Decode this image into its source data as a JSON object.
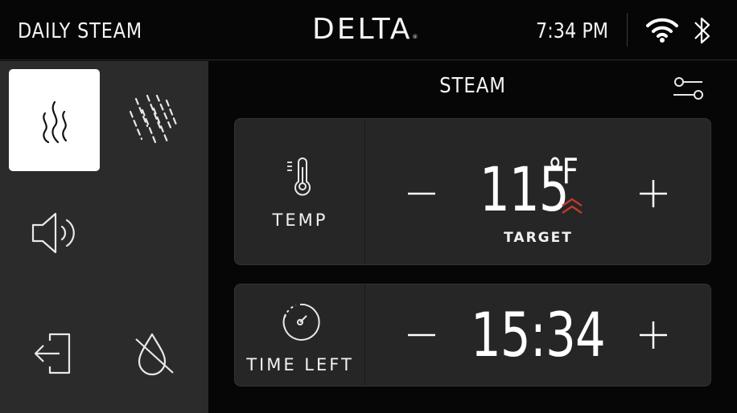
{
  "header": {
    "mode_title": "DAILY STEAM",
    "brand": "DELTA",
    "brand_mark": "®",
    "time": "7:34 PM",
    "icons": [
      "wifi-icon",
      "bluetooth-icon"
    ]
  },
  "sidebar": {
    "items": [
      {
        "name": "steam",
        "icon": "steam-icon",
        "active": true
      },
      {
        "name": "rain-shower",
        "icon": "rain-icon",
        "active": false
      },
      {
        "name": "audio",
        "icon": "speaker-icon",
        "active": false
      },
      {
        "name": "exit",
        "icon": "exit-icon",
        "active": false
      },
      {
        "name": "water-off",
        "icon": "water-off-icon",
        "active": false
      }
    ]
  },
  "main": {
    "section_title": "STEAM",
    "settings_icon": "filter-sliders-icon",
    "temp_card": {
      "label": "TEMP",
      "icon": "thermometer-icon",
      "value": "115",
      "unit": "°F",
      "sub_label": "TARGET",
      "indicator": "rising-chevrons-icon",
      "minus": "−",
      "plus": "+"
    },
    "time_card": {
      "label": "TIME LEFT",
      "icon": "timer-icon",
      "value": "15:34",
      "minus": "−",
      "plus": "+"
    }
  },
  "colors": {
    "background": "#060606",
    "sidebar": "#2b2b2b",
    "card": "#262626",
    "accent_red": "#c0392b",
    "text": "#f2f2f2"
  }
}
